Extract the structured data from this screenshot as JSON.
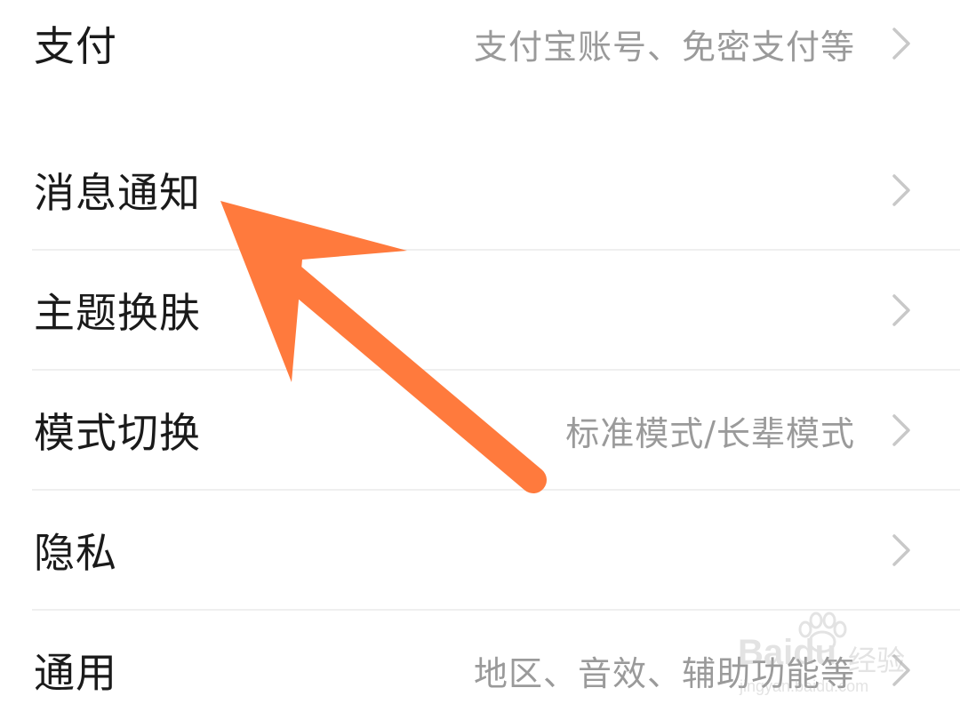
{
  "settings": {
    "items": [
      {
        "label": "支付",
        "value": "支付宝账号、免密支付等"
      },
      {
        "label": "消息通知",
        "value": ""
      },
      {
        "label": "主题换肤",
        "value": ""
      },
      {
        "label": "模式切换",
        "value": "标准模式/长辈模式"
      },
      {
        "label": "隐私",
        "value": ""
      },
      {
        "label": "通用",
        "value": "地区、音效、辅助功能等"
      }
    ]
  },
  "annotation": {
    "arrow_color": "#FF7A3D",
    "points_to": "消息通知"
  },
  "watermark": {
    "brand": "Baidu",
    "cn": "经验",
    "sub": "jingyan.baidu.com"
  },
  "colors": {
    "label": "#1a1a1a",
    "value": "#9a9a9a",
    "chevron": "#c8c8c8",
    "divider": "#efefef"
  }
}
